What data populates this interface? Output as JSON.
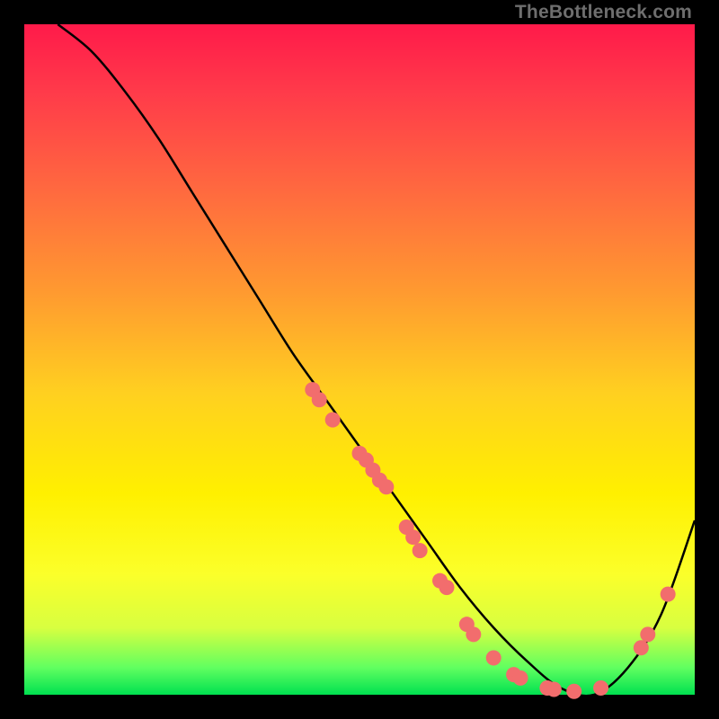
{
  "watermark": "TheBottleneck.com",
  "chart_data": {
    "type": "line",
    "title": "",
    "xlabel": "",
    "ylabel": "",
    "xlim": [
      0,
      100
    ],
    "ylim": [
      0,
      100
    ],
    "series": [
      {
        "name": "curve",
        "x": [
          5,
          10,
          15,
          20,
          25,
          30,
          35,
          40,
          45,
          50,
          55,
          60,
          65,
          70,
          75,
          80,
          85,
          90,
          95,
          100
        ],
        "y": [
          100,
          96,
          90,
          83,
          75,
          67,
          59,
          51,
          44,
          37,
          30,
          23,
          16,
          10,
          5,
          1,
          0,
          4,
          12,
          26
        ]
      }
    ],
    "markers": [
      {
        "x": 43,
        "y": 45.5
      },
      {
        "x": 44,
        "y": 44
      },
      {
        "x": 46,
        "y": 41
      },
      {
        "x": 50,
        "y": 36
      },
      {
        "x": 51,
        "y": 35
      },
      {
        "x": 52,
        "y": 33.5
      },
      {
        "x": 53,
        "y": 32
      },
      {
        "x": 54,
        "y": 31
      },
      {
        "x": 57,
        "y": 25
      },
      {
        "x": 58,
        "y": 23.5
      },
      {
        "x": 59,
        "y": 21.5
      },
      {
        "x": 62,
        "y": 17
      },
      {
        "x": 63,
        "y": 16
      },
      {
        "x": 66,
        "y": 10.5
      },
      {
        "x": 67,
        "y": 9
      },
      {
        "x": 70,
        "y": 5.5
      },
      {
        "x": 73,
        "y": 3
      },
      {
        "x": 74,
        "y": 2.5
      },
      {
        "x": 78,
        "y": 1
      },
      {
        "x": 79,
        "y": 0.8
      },
      {
        "x": 82,
        "y": 0.5
      },
      {
        "x": 86,
        "y": 1
      },
      {
        "x": 92,
        "y": 7
      },
      {
        "x": 93,
        "y": 9
      },
      {
        "x": 96,
        "y": 15
      }
    ],
    "colors": {
      "curve": "#000000",
      "marker_fill": "#f26d6d",
      "marker_stroke": "#e85a5a"
    }
  }
}
